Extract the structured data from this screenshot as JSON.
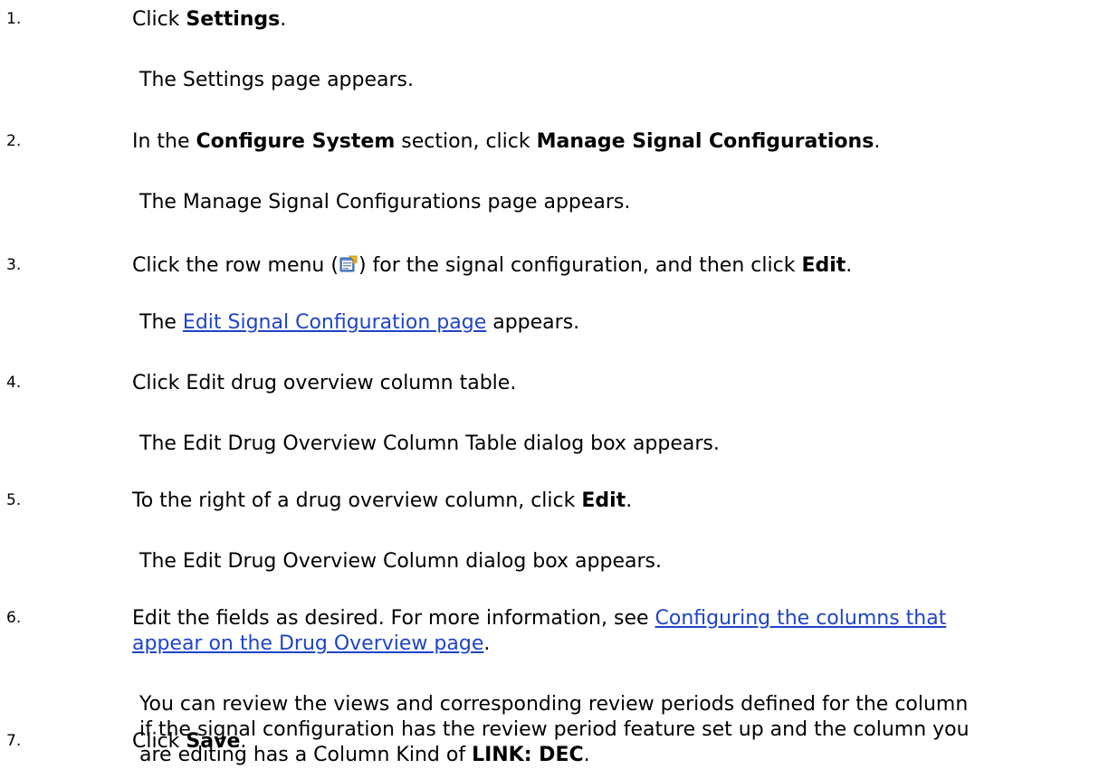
{
  "steps": [
    {
      "number": "1.",
      "instruction": {
        "pre": "Click ",
        "b1": "Settings",
        "post": "."
      },
      "result": "The Settings page appears."
    },
    {
      "number": "2.",
      "instruction": {
        "pre": "In the ",
        "b1": "Configure System",
        "mid": " section, click ",
        "b2": "Manage Signal Configurations",
        "post": "."
      },
      "result": "The Manage Signal Configurations page appears."
    },
    {
      "number": "3.",
      "instruction": {
        "pre": "Click the row menu (",
        "icon": "row-menu-icon",
        "mid": ") for the signal configuration, and then click ",
        "b1": "Edit",
        "post": "."
      },
      "result": {
        "pre": "The ",
        "link": "Edit Signal Configuration page",
        "post": " appears."
      }
    },
    {
      "number": "4.",
      "instruction": {
        "text": "Click Edit drug overview column table."
      },
      "result": "The Edit Drug Overview Column Table dialog box appears."
    },
    {
      "number": "5.",
      "instruction": {
        "pre": "To the right of a drug overview column, click ",
        "b1": "Edit",
        "post": "."
      },
      "result": "The Edit Drug Overview Column dialog box appears."
    },
    {
      "number": "6.",
      "instruction": {
        "pre": "Edit the fields as desired. For more information, see ",
        "link1": "Configuring the columns that",
        "link2": "appear on the Drug Overview page",
        "post": "."
      },
      "result": {
        "line1": "You can review the views and corresponding review periods defined for the column",
        "line2": "if the signal configuration has the review period feature set up and the column you",
        "line3_pre": "are editing has a Column Kind of ",
        "line3_b": "LINK: DEC",
        "line3_post": "."
      }
    },
    {
      "number": "7.",
      "instruction": {
        "pre": "Click ",
        "b1": "Save",
        "post": "."
      }
    }
  ],
  "colors": {
    "link": "#1f44c9",
    "text": "#000000",
    "background": "#ffffff"
  }
}
